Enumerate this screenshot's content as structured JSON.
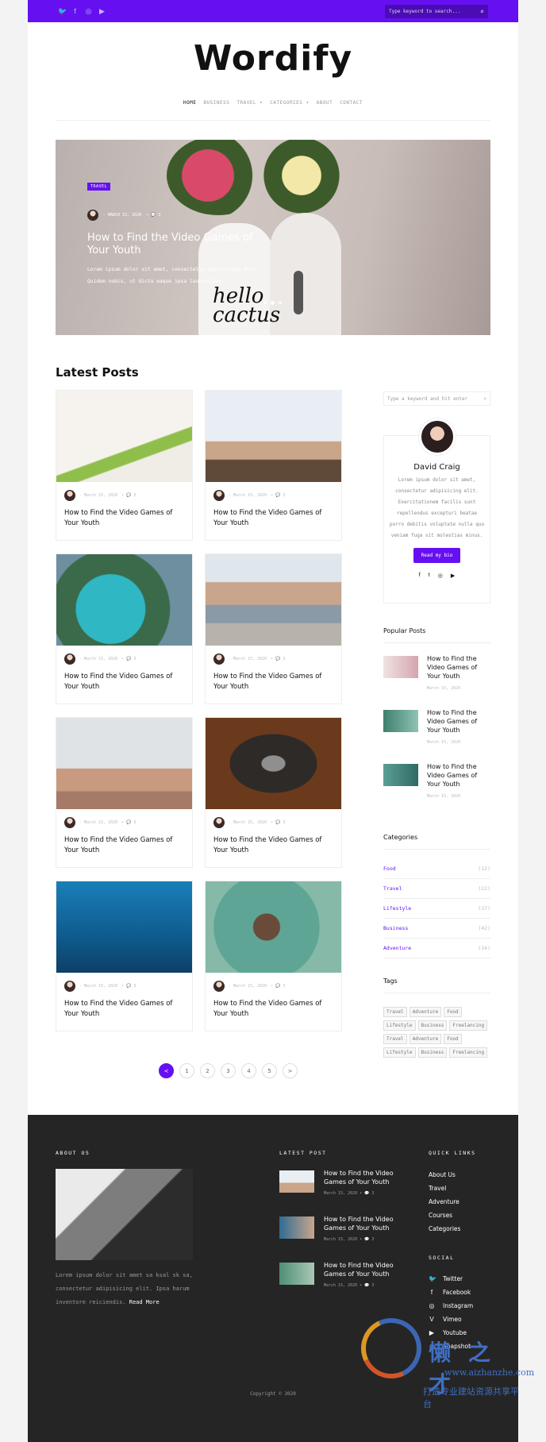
{
  "topbar": {
    "social_icons": [
      "twitter-icon",
      "facebook-icon",
      "instagram-icon",
      "youtube-icon"
    ],
    "search_placeholder": "Type keyword to search...",
    "accent": "#6610f2"
  },
  "logo": "Wordify",
  "nav": [
    {
      "label": "HOME",
      "active": true
    },
    {
      "label": "BUSINESS"
    },
    {
      "label": "TRAVEL ▾"
    },
    {
      "label": "CATEGORIES ▾"
    },
    {
      "label": "ABOUT"
    },
    {
      "label": "CONTACT"
    }
  ],
  "hero": {
    "badge": "TRAVEL",
    "date": "- MARCH 15, 2020",
    "comments": "• 💬 3",
    "title": "How to Find the Video Games of Your Youth",
    "text": "Lorem ipsum dolor sit amet, consectetur adipisicing elit. Quidem nobis, ut dicta eaque ipsa laudantium!",
    "slide_count": 3,
    "active_slide": 2,
    "image_text": "hello cactus"
  },
  "latest_title": "Latest Posts",
  "posts": [
    {
      "title": "How to Find the Video Games of Your Youth",
      "date": "- March 15, 2020",
      "comments": "• 💬 3"
    },
    {
      "title": "How to Find the Video Games of Your Youth",
      "date": "- March 15, 2020",
      "comments": "• 💬 3"
    },
    {
      "title": "How to Find the Video Games of Your Youth",
      "date": "- March 15, 2020",
      "comments": "• 💬 3"
    },
    {
      "title": "How to Find the Video Games of Your Youth",
      "date": "- March 15, 2020",
      "comments": "• 💬 3"
    },
    {
      "title": "How to Find the Video Games of Your Youth",
      "date": "- March 15, 2020",
      "comments": "• 💬 3"
    },
    {
      "title": "How to Find the Video Games of Your Youth",
      "date": "- March 15, 2020",
      "comments": "• 💬 3"
    },
    {
      "title": "How to Find the Video Games of Your Youth",
      "date": "- March 15, 2020",
      "comments": "• 💬 3"
    },
    {
      "title": "How to Find the Video Games of Your Youth",
      "date": "- March 15, 2020",
      "comments": "• 💬 3"
    }
  ],
  "pagination": [
    "<",
    "1",
    "2",
    "3",
    "4",
    "5",
    ">"
  ],
  "sidebar": {
    "search_placeholder": "Type a keyword and hit enter",
    "bio": {
      "name": "David Craig",
      "text": "Lorem ipsum dolor sit amet, consectetur adipisicing elit. Exercitationem facilis sunt repellendus excepturi beatae porro debitis voluptate nulla quo veniam fuga sit molestias minus.",
      "button": "Read my bio",
      "socials": [
        "f",
        "t",
        "◎",
        "▶"
      ]
    },
    "popular_title": "Popular Posts",
    "popular": [
      {
        "title": "How to Find the Video Games of Your Youth",
        "date": "March 15, 2020"
      },
      {
        "title": "How to Find the Video Games of Your Youth",
        "date": "March 15, 2020"
      },
      {
        "title": "How to Find the Video Games of Your Youth",
        "date": "March 15, 2020"
      }
    ],
    "categories_title": "Categories",
    "categories": [
      {
        "name": "Food",
        "count": "(12)"
      },
      {
        "name": "Travel",
        "count": "(22)"
      },
      {
        "name": "Lifestyle",
        "count": "(37)"
      },
      {
        "name": "Business",
        "count": "(42)"
      },
      {
        "name": "Adventure",
        "count": "(14)"
      }
    ],
    "tags_title": "Tags",
    "tags": [
      "Travel",
      "Adventure",
      "Food",
      "Lifestyle",
      "Business",
      "Freelancing",
      "Travel",
      "Adventure",
      "Food",
      "Lifestyle",
      "Business",
      "Freelancing"
    ]
  },
  "footer": {
    "about_title": "ABOUT US",
    "about_text": "Lorem ipsum dolor sit amet sa ksal sk sa, consectetur adipisicing elit. Ipsa harum inventore reiciendis.",
    "read_more": "Read More",
    "latest_title": "LATEST POST",
    "latest": [
      {
        "title": "How to Find the Video Games of Your Youth",
        "date": "March 15, 2020",
        "comments": "• 💬 3"
      },
      {
        "title": "How to Find the Video Games of Your Youth",
        "date": "March 15, 2020",
        "comments": "• 💬 3"
      },
      {
        "title": "How to Find the Video Games of Your Youth",
        "date": "March 15, 2020",
        "comments": "• 💬 3"
      }
    ],
    "quick_title": "QUICK LINKS",
    "quick_links": [
      "About Us",
      "Travel",
      "Adventure",
      "Courses",
      "Categories"
    ],
    "social_title": "SOCIAL",
    "social": [
      {
        "icon": "🐦",
        "label": "Twitter"
      },
      {
        "icon": "f",
        "label": "Facebook"
      },
      {
        "icon": "◎",
        "label": "Instagram"
      },
      {
        "icon": "V",
        "label": "Vimeo"
      },
      {
        "icon": "▶",
        "label": "Youtube"
      },
      {
        "icon": "☺",
        "label": "Snapshot"
      }
    ],
    "copyright": "Copyright © 2020"
  },
  "watermark": {
    "text": "懒之才",
    "url": "www.aizhanzhe.com",
    "sub": "打造专业建站资源共享平台"
  }
}
